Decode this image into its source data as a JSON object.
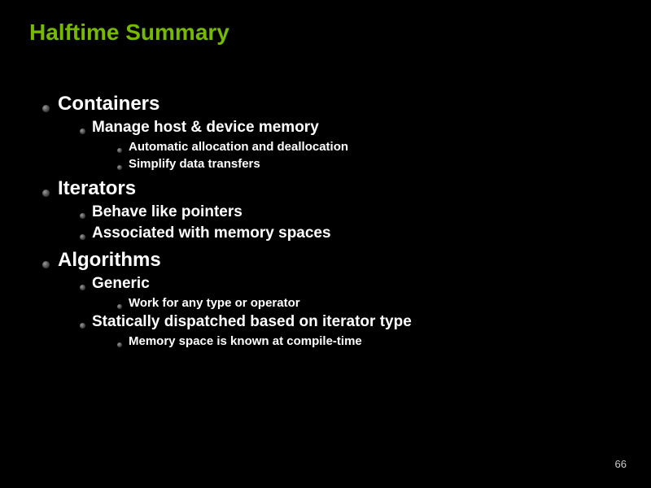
{
  "title": "Halftime Summary",
  "sections": [
    {
      "heading": "Containers",
      "items": [
        {
          "text": "Manage host & device memory",
          "subitems": [
            "Automatic allocation and deallocation",
            "Simplify data transfers"
          ]
        }
      ]
    },
    {
      "heading": "Iterators",
      "items": [
        {
          "text": "Behave like pointers",
          "subitems": []
        },
        {
          "text": "Associated with memory spaces",
          "subitems": []
        }
      ]
    },
    {
      "heading": "Algorithms",
      "items": [
        {
          "text": "Generic",
          "subitems": [
            "Work for any type or operator"
          ]
        },
        {
          "text": "Statically dispatched based on iterator type",
          "subitems": [
            "Memory space is known at compile-time"
          ]
        }
      ]
    }
  ],
  "page_number": "66"
}
